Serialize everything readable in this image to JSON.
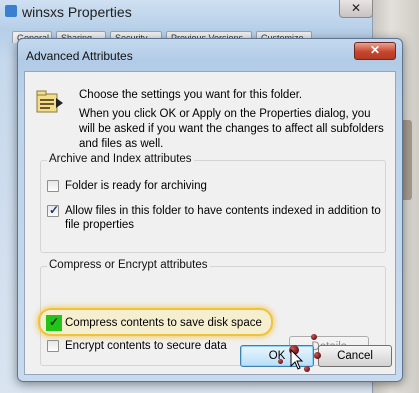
{
  "parent_window": {
    "title": "winsxs Properties",
    "tabs": [
      "General",
      "Sharing",
      "Security",
      "Previous Versions",
      "Customize"
    ],
    "close_glyph": "✕"
  },
  "dialog": {
    "title": "Advanced Attributes",
    "close_glyph": "✕",
    "description_line1": "Choose the settings you want for this folder.",
    "description_line2": "When you click OK or Apply on the Properties dialog, you will be asked if you want the changes to affect all subfolders and files as well.",
    "icon": "folder-attributes-icon"
  },
  "archive_group": {
    "label": "Archive and Index attributes",
    "options": [
      {
        "label": "Folder is ready for archiving",
        "checked": false
      },
      {
        "label": "Allow files in this folder to have contents indexed in addition to file properties",
        "checked": true
      }
    ]
  },
  "compress_group": {
    "label": "Compress or Encrypt attributes",
    "options": [
      {
        "label": "Compress contents to save disk space",
        "checked": true,
        "highlighted": true
      },
      {
        "label": "Encrypt contents to secure data",
        "checked": false
      }
    ],
    "details_button": "Details"
  },
  "buttons": {
    "ok": "OK",
    "cancel": "Cancel"
  },
  "colors": {
    "highlight_ring": "#efc23c",
    "highlight_checkbox": "#22c41a",
    "close_button": "#c7452d"
  }
}
